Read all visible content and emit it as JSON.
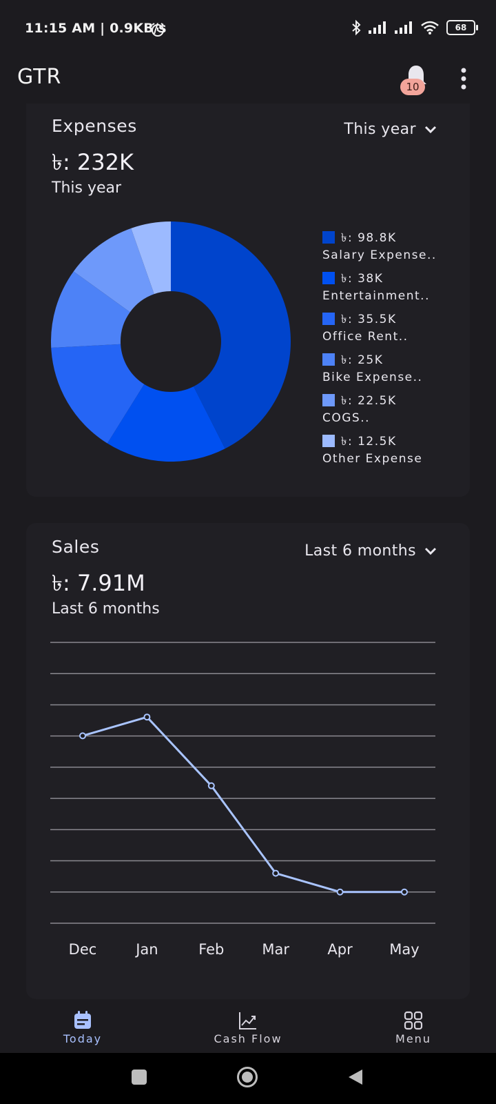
{
  "status_bar": {
    "time": "11:15 AM | 0.9KB/s",
    "battery": "68"
  },
  "app_bar": {
    "title": "GTR",
    "notification_count": "10"
  },
  "expenses_card": {
    "title": "Expenses",
    "amount": "৳: 232K",
    "period": "This year",
    "dropdown_label": "This year",
    "legend": [
      {
        "value": "৳: 98.8K",
        "name": "Salary Expense..",
        "color": "#0044cc"
      },
      {
        "value": "৳: 38K",
        "name": "Entertainment..",
        "color": "#0050f0"
      },
      {
        "value": "৳: 35.5K",
        "name": "Office Rent..",
        "color": "#2565f5"
      },
      {
        "value": "৳: 25K",
        "name": "Bike Expense..",
        "color": "#4d82f7"
      },
      {
        "value": "৳: 22.5K",
        "name": "COGS..",
        "color": "#6e99fa"
      },
      {
        "value": "৳: 12.5K",
        "name": "Other Expense",
        "color": "#9cbaff"
      }
    ]
  },
  "sales_card": {
    "title": "Sales",
    "amount": "৳: 7.91M",
    "period": "Last 6 months",
    "dropdown_label": "Last 6 months"
  },
  "chart_data": [
    {
      "type": "pie",
      "donut": true,
      "categories": [
        "Salary Expense..",
        "Entertainment..",
        "Office Rent..",
        "Bike Expense..",
        "COGS..",
        "Other Expense"
      ],
      "values": [
        98.8,
        38,
        35.5,
        25,
        22.5,
        12.5
      ],
      "colors": [
        "#0044cc",
        "#0050f0",
        "#2565f5",
        "#4d82f7",
        "#6e99fa",
        "#9cbaff"
      ],
      "legend": "right"
    },
    {
      "type": "line",
      "categories": [
        "Dec",
        "Jan",
        "Feb",
        "Mar",
        "Apr",
        "May"
      ],
      "values": [
        2.5,
        2.8,
        1.7,
        0.3,
        0.0,
        0.0
      ],
      "ylim": [
        -0.5,
        3.995
      ],
      "grid": true,
      "line_color": "#a9c4ff"
    }
  ],
  "bottom_nav": {
    "items": [
      {
        "label": "Today",
        "icon": "calendar-icon",
        "active": true
      },
      {
        "label": "Cash Flow",
        "icon": "chart-line-icon",
        "active": false
      },
      {
        "label": "Menu",
        "icon": "grid-icon",
        "active": false
      }
    ]
  }
}
